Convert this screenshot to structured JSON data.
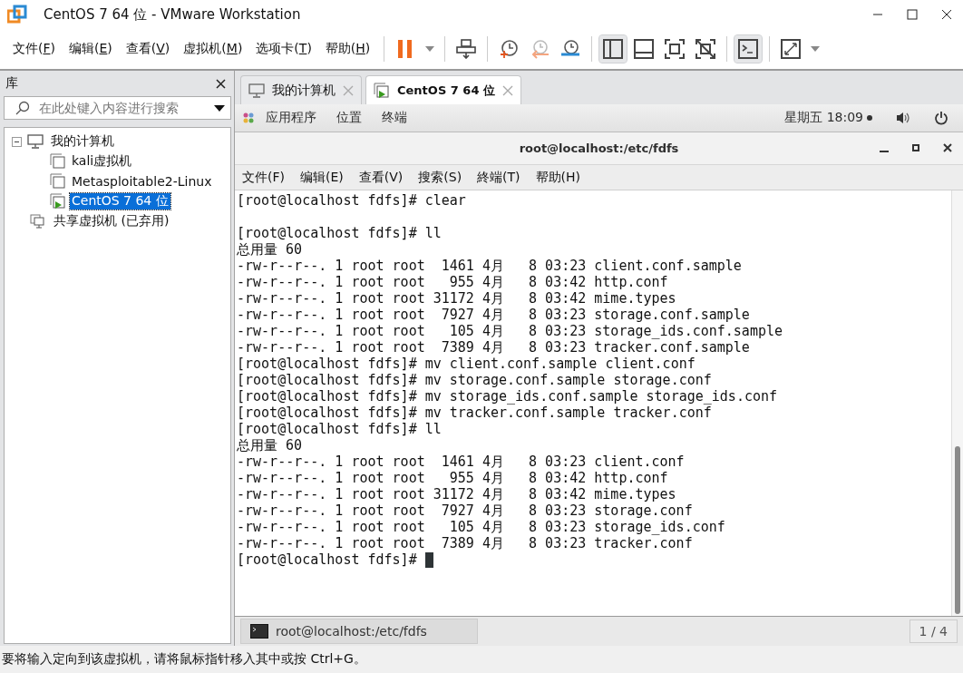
{
  "window": {
    "title": "CentOS 7 64 位 - VMware Workstation"
  },
  "menu": [
    "文件(F)",
    "编辑(E)",
    "查看(V)",
    "虚拟机(M)",
    "选项卡(T)",
    "帮助(H)"
  ],
  "toolbar": [
    [
      {
        "kind": "pause"
      },
      {
        "kind": "dropdown"
      }
    ],
    [
      {
        "kind": "send-keys"
      }
    ],
    [
      {
        "kind": "snapshot-take"
      },
      {
        "kind": "snapshot-revert"
      },
      {
        "kind": "snapshot-manager"
      }
    ],
    [
      {
        "kind": "view-library",
        "pressed": true
      },
      {
        "kind": "view-thumbnail",
        "pressed": false
      },
      {
        "kind": "view-full",
        "pressed": false
      },
      {
        "kind": "view-unity",
        "pressed": false
      }
    ],
    [
      {
        "kind": "console",
        "pressed": true
      }
    ],
    [
      {
        "kind": "stretch"
      },
      {
        "kind": "dropdown"
      }
    ]
  ],
  "library": {
    "title": "库",
    "search": {
      "placeholder": "在此处键入内容进行搜索"
    },
    "tree": [
      {
        "label": "我的计算机",
        "kind": "computer",
        "expanded": true,
        "selected": false,
        "children": [
          {
            "label": "kali虚拟机",
            "kind": "vm",
            "running": false,
            "selected": false
          },
          {
            "label": "Metasploitable2-Linux",
            "kind": "vm",
            "running": false,
            "selected": false
          },
          {
            "label": "CentOS 7 64 位",
            "kind": "vm",
            "running": true,
            "selected": true
          }
        ]
      },
      {
        "label": "共享虚拟机 (已弃用)",
        "kind": "shared",
        "selected": false
      }
    ]
  },
  "tabs": [
    {
      "label": "我的计算机",
      "kind": "home",
      "selected": false
    },
    {
      "label": "CentOS 7 64 位",
      "kind": "vm",
      "selected": true
    }
  ],
  "gnome_bar": {
    "menus": [
      "应用程序",
      "位置",
      "终端"
    ],
    "clock": "星期五 18:09"
  },
  "terminal": {
    "title": "root@localhost:/etc/fdfs",
    "menu": [
      "文件(F)",
      "编辑(E)",
      "查看(V)",
      "搜索(S)",
      "終端(T)",
      "帮助(H)"
    ],
    "blocks": [
      {
        "lines": [
          {
            "text": "[root@localhost fdfs]# clear"
          }
        ]
      },
      {
        "lines": [
          {
            "text": "[root@localhost fdfs]# ll"
          },
          {
            "text": "总用量 60"
          },
          {
            "text": "-rw-r--r--. 1 root root  1461 4月   8 03:23 client.conf.sample"
          },
          {
            "text": "-rw-r--r--. 1 root root   955 4月   8 03:42 http.conf"
          },
          {
            "text": "-rw-r--r--. 1 root root 31172 4月   8 03:42 mime.types"
          },
          {
            "text": "-rw-r--r--. 1 root root  7927 4月   8 03:23 storage.conf.sample"
          },
          {
            "text": "-rw-r--r--. 1 root root   105 4月   8 03:23 storage_ids.conf.sample"
          },
          {
            "text": "-rw-r--r--. 1 root root  7389 4月   8 03:23 tracker.conf.sample"
          },
          {
            "text": "[root@localhost fdfs]# mv client.conf.sample client.conf"
          },
          {
            "text": "[root@localhost fdfs]# mv storage.conf.sample storage.conf"
          },
          {
            "text": "[root@localhost fdfs]# mv storage_ids.conf.sample storage_ids.conf"
          },
          {
            "text": "[root@localhost fdfs]# mv tracker.conf.sample tracker.conf"
          },
          {
            "text": "[root@localhost fdfs]# ll"
          },
          {
            "text": "总用量 60"
          },
          {
            "text": "-rw-r--r--. 1 root root  1461 4月   8 03:23 client.conf"
          },
          {
            "text": "-rw-r--r--. 1 root root   955 4月   8 03:42 http.conf"
          },
          {
            "text": "-rw-r--r--. 1 root root 31172 4月   8 03:42 mime.types"
          },
          {
            "text": "-rw-r--r--. 1 root root  7927 4月   8 03:23 storage.conf"
          },
          {
            "text": "-rw-r--r--. 1 root root   105 4月   8 03:23 storage_ids.conf"
          },
          {
            "text": "-rw-r--r--. 1 root root  7389 4月   8 03:23 tracker.conf"
          },
          {
            "text": "[root@localhost fdfs]# ",
            "cursor": true
          }
        ]
      }
    ]
  },
  "taskbar": {
    "windows": [
      {
        "label": "root@localhost:/etc/fdfs",
        "selected": true
      }
    ],
    "workspace": "1 / 4"
  },
  "status_bar": "要将输入定向到该虚拟机，请将鼠标指针移入其中或按 Ctrl+G。"
}
